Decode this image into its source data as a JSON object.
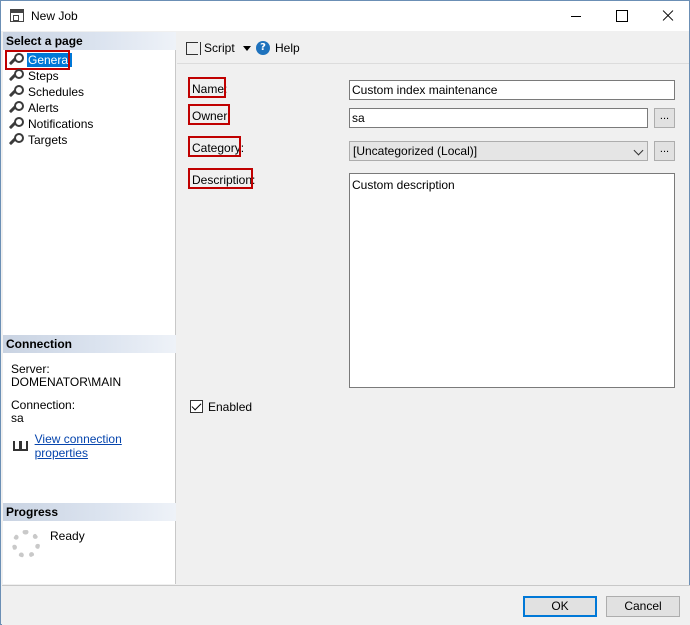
{
  "window": {
    "title": "New Job"
  },
  "sidebar": {
    "select_page_header": "Select a page",
    "items": [
      {
        "label": "General",
        "icon": "wrench-icon",
        "active": true
      },
      {
        "label": "Steps",
        "icon": "wrench-icon"
      },
      {
        "label": "Schedules",
        "icon": "wrench-icon"
      },
      {
        "label": "Alerts",
        "icon": "wrench-icon"
      },
      {
        "label": "Notifications",
        "icon": "wrench-icon"
      },
      {
        "label": "Targets",
        "icon": "wrench-icon"
      }
    ],
    "connection_header": "Connection",
    "server_label": "Server:",
    "server_value": "DOMENATOR\\MAIN",
    "connection_label": "Connection:",
    "connection_value": "sa",
    "view_connection_link": "View connection properties",
    "progress_header": "Progress",
    "progress_status": "Ready"
  },
  "toolbar": {
    "script_label": "Script",
    "help_label": "Help"
  },
  "form": {
    "name_label": "Name:",
    "name_value": "Custom index maintenance",
    "owner_label": "Owner:",
    "owner_value": "sa",
    "category_label": "Category:",
    "category_value": "[Uncategorized (Local)]",
    "description_label": "Description:",
    "description_value": "Custom description",
    "enabled_label": "Enabled",
    "enabled_checked": true,
    "browse_label": "..."
  },
  "footer": {
    "ok_label": "OK",
    "cancel_label": "Cancel"
  },
  "colors": {
    "highlight_border": "#c00000",
    "selection": "#0078d7",
    "link": "#0645ad"
  }
}
